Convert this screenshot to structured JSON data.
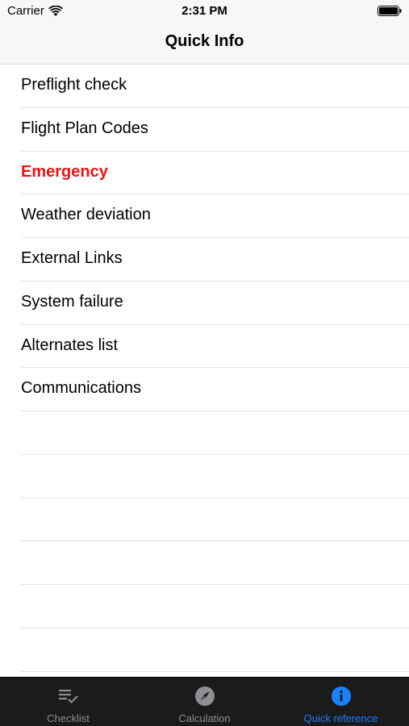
{
  "status_bar": {
    "carrier": "Carrier",
    "time": "2:31 PM"
  },
  "nav": {
    "title": "Quick Info"
  },
  "list": {
    "items": [
      {
        "label": "Preflight check"
      },
      {
        "label": "Flight Plan Codes"
      },
      {
        "label": "Emergency",
        "highlight_color": "#ee1111"
      },
      {
        "label": "Weather deviation"
      },
      {
        "label": "External Links"
      },
      {
        "label": "System failure"
      },
      {
        "label": "Alternates list"
      },
      {
        "label": "Communications"
      }
    ]
  },
  "tab_bar": {
    "tabs": [
      {
        "label": "Checklist",
        "icon": "checklist-icon"
      },
      {
        "label": "Calculation",
        "icon": "compass-icon"
      },
      {
        "label": "Quick reference",
        "icon": "info-icon",
        "selected": true
      }
    ],
    "active_color": "#1a82ff",
    "inactive_color": "#8e8e93"
  }
}
